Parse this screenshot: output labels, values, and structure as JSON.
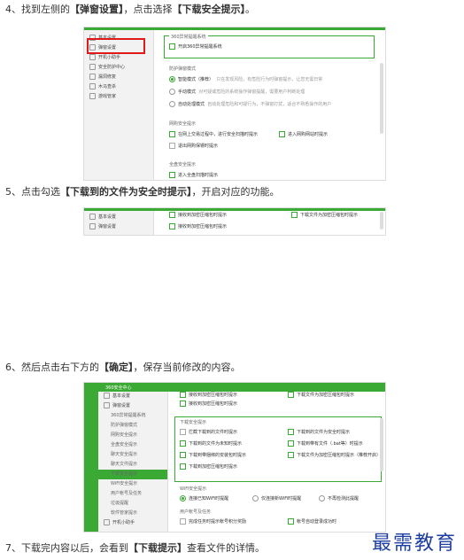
{
  "steps": [
    {
      "pre": "4、找到左侧的",
      "bold1": "【弹窗设置】",
      "mid": "，点击选择",
      "bold2": "【下载安全提示】",
      "post": "。"
    },
    {
      "pre": "5、点击勾选",
      "bold1": "【下载到的文件为安全时提示】",
      "mid": "，开启对应的功能。",
      "bold2": "",
      "post": ""
    },
    {
      "pre": "6、然后点击右下方的",
      "bold1": "【确定】",
      "mid": "，保存当前修改的内容。",
      "bold2": "",
      "post": ""
    },
    {
      "pre": "7、下载完内容以后，会看到",
      "bold1": "【下载提示】",
      "mid": "查看文件的详情。",
      "bold2": "",
      "post": ""
    }
  ],
  "shot1": {
    "sidebar": [
      "基本设置",
      "弹窗设置",
      "开机小助手",
      "安全防护中心",
      "漏洞修复",
      "木马查杀",
      "游戏管家"
    ],
    "sec1": "360异常提醒系统",
    "opt1": "开启360异常提醒系统",
    "sec2": "防护弹窗模式",
    "modes": [
      {
        "label": "智能模式（推荐）",
        "desc": "只在发现风险，有危险行为时弹窗提示，让您无需日常"
      },
      {
        "label": "手动模式",
        "desc": "对可疑或危险的系统操作弹窗提醒，需要用户判断处理"
      },
      {
        "label": "自动处理模式",
        "desc": "自动处理危险和可疑行为，不弹窗打扰，适合不熟悉操作的用户"
      }
    ],
    "sec3": "网购安全提示",
    "shop": [
      "在网上交易过程中，进行安全扫描时提示",
      "进入网购网站时提示",
      "退出网购保镖时提示"
    ],
    "sec4": "全盘安全提示",
    "disk": "进入全盘扫描时提示"
  },
  "shot2": {
    "sidebar": [
      "基本设置",
      "弹窗设置"
    ],
    "row_top_left": "接收到加密压缩包时提示",
    "row_top_right": "下载文件为加密压缩包时提示",
    "row2": "接收到加密压缩包时提示"
  },
  "shot3": {
    "title": "360安全中心",
    "sidebar": [
      "基本设置",
      "弹窗设置",
      "360异常提醒系统",
      "防护弹窗模式",
      "网购安全提示",
      "全盘安全提示",
      "聊天安全提示",
      "聊天文件提示",
      "下载安全提示",
      "WiFi安全提示",
      "用户帐号及任务",
      "垃圾提醒",
      "软件管家提示",
      "开机小助手"
    ],
    "active_index": 8,
    "top_rows": [
      "接收到加密压缩包时提示",
      "接收到加密压缩包时提示"
    ],
    "top_right": "下载文件为加密压缩包时提示",
    "sec_dl": "下载安全提示",
    "dl_left": [
      "拦截下载到的文件时提示",
      "下载到的文件为未知时提示",
      "下载到带捆绑的安装包时提示",
      "下载到加密压缩包时提示"
    ],
    "dl_right": [
      "下载到的文件为安全时提示",
      "下载到带有文件（.bat等）时提示",
      "下载文件为加密压缩包时提示（推荐开启）"
    ],
    "sec_wifi": "WiFi安全提示",
    "wifi": [
      "连接已知WiFi时提醒",
      "仅连接新WiFi时提醒",
      "不再检测此提醒"
    ],
    "sec_user": "用户帐号及任务",
    "user_left": "完成任务时提示帐号积分奖励",
    "user_right": "帐号自动登录成功时"
  },
  "watermark": "最需教育"
}
